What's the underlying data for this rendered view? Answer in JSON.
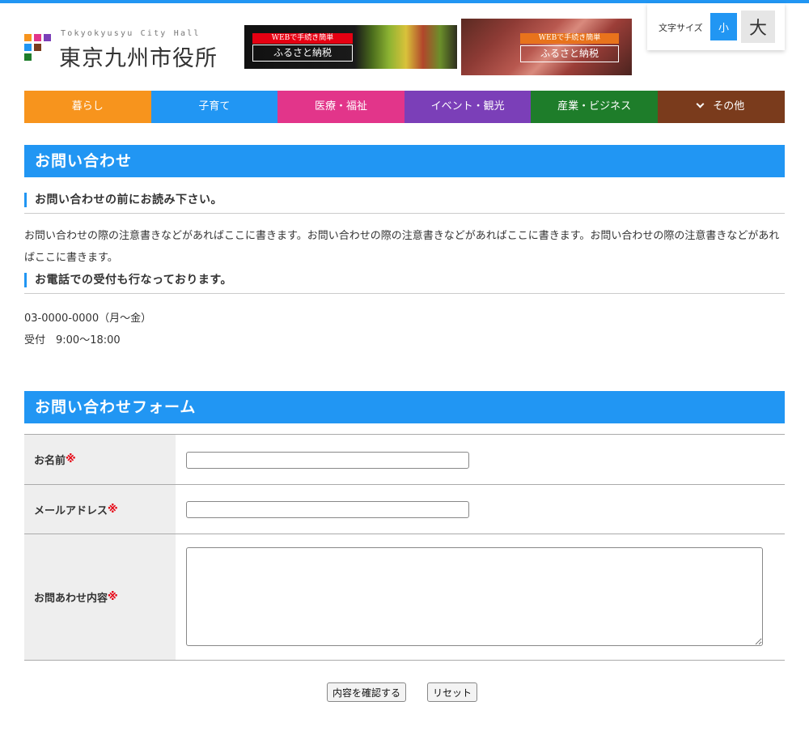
{
  "header": {
    "logo_sub": "Tokyokyusyu City Hall",
    "logo_main": "東京九州市役所",
    "banners": [
      {
        "tag": "WEBで手続き簡単",
        "title": "ふるさと納税"
      },
      {
        "tag": "WEBで手続き簡単",
        "title": "ふるさと納税"
      }
    ],
    "font_size": {
      "label": "文字サイズ",
      "small": "小",
      "large": "大"
    }
  },
  "nav": {
    "items": [
      {
        "label": "暮らし",
        "color": "#f7941d"
      },
      {
        "label": "子育て",
        "color": "#2196f3"
      },
      {
        "label": "医療・福祉",
        "color": "#e2358a"
      },
      {
        "label": "イベント・観光",
        "color": "#7b3fb8"
      },
      {
        "label": "産業・ビジネス",
        "color": "#1e7d2a"
      },
      {
        "label": "その他",
        "color": "#7a3b1c"
      }
    ]
  },
  "inquiry": {
    "title": "お問い合わせ",
    "notice_heading": "お問い合わせの前にお読み下さい。",
    "notice_text": "お問い合わせの際の注意書きなどがあればここに書きます。お問い合わせの際の注意書きなどがあればここに書きます。お問い合わせの際の注意書きなどがあればここに書きます。",
    "phone_heading": "お電話での受付も行なっております。",
    "phone_number": "03-0000-0000（月〜金）",
    "hours": "受付　9:00〜18:00"
  },
  "form": {
    "title": "お問い合わせフォーム",
    "required_mark": "※",
    "name_label": "お名前",
    "name_value": "",
    "email_label": "メールアドレス",
    "email_value": "",
    "content_label": "お問あわせ内容",
    "content_value": "",
    "confirm_label": "内容を確認する",
    "reset_label": "リセット"
  },
  "colors": {
    "accent": "#2196f3",
    "required": "#e60012"
  }
}
